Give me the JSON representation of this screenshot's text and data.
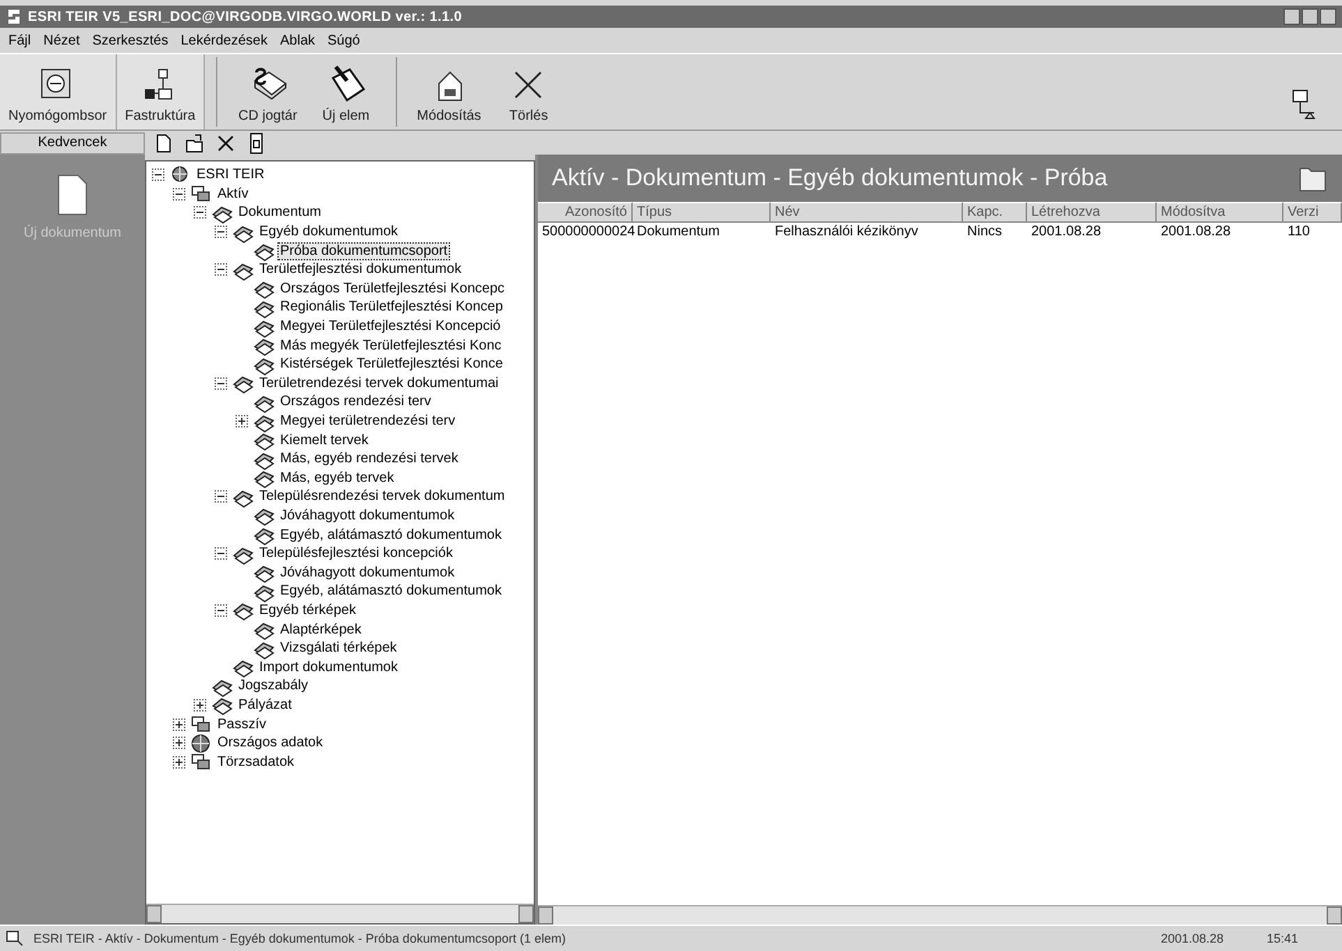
{
  "window": {
    "title": "ESRI TEIR V5_ESRI_DOC@VIRGODB.VIRGO.WORLD  ver.: 1.1.0"
  },
  "menu": [
    "Fájl",
    "Nézet",
    "Szerkesztés",
    "Lekérdezések",
    "Ablak",
    "Súgó"
  ],
  "toolbar": [
    {
      "kind": "keypad",
      "label": "Nyomógombsor"
    },
    {
      "kind": "tree",
      "label": "Fastruktúra"
    },
    {
      "kind": "book",
      "label": "CD jogtár"
    },
    {
      "kind": "pen",
      "label": "Új elem"
    },
    {
      "kind": "edit",
      "label": "Módosítás"
    },
    {
      "kind": "delete",
      "label": "Törlés"
    }
  ],
  "favorites": {
    "title": "Kedvencek",
    "items": [
      {
        "label": "Új dokumentum"
      }
    ]
  },
  "tree": {
    "items": [
      {
        "label": "ESRI TEIR",
        "kind": "root",
        "expanded": true,
        "selected": false,
        "children": [
          {
            "label": "Aktív",
            "kind": "group",
            "expanded": true,
            "selected": false,
            "children": [
              {
                "label": "Dokumentum",
                "kind": "folder",
                "expanded": true,
                "selected": false,
                "children": [
                  {
                    "label": "Egyéb dokumentumok",
                    "kind": "folder",
                    "expanded": true,
                    "selected": false,
                    "children": [
                      {
                        "label": "Próba dokumentumcsoport",
                        "kind": "folder",
                        "selected": true
                      }
                    ]
                  },
                  {
                    "label": "Területfejlesztési dokumentumok",
                    "kind": "folder",
                    "expanded": true,
                    "selected": false,
                    "children": [
                      {
                        "label": "Országos Területfejlesztési Koncepc",
                        "kind": "folder",
                        "selected": false
                      },
                      {
                        "label": "Regionális Területfejlesztési Koncep",
                        "kind": "folder",
                        "selected": false
                      },
                      {
                        "label": "Megyei Területfejlesztési Koncepció",
                        "kind": "folder",
                        "selected": false
                      },
                      {
                        "label": "Más megyék Területfejlesztési Konc",
                        "kind": "folder",
                        "selected": false
                      },
                      {
                        "label": "Kistérségek Területfejlesztési Konce",
                        "kind": "folder",
                        "selected": false
                      }
                    ]
                  },
                  {
                    "label": "Területrendezési tervek dokumentumai",
                    "kind": "folder",
                    "expanded": true,
                    "selected": false,
                    "children": [
                      {
                        "label": "Országos rendezési terv",
                        "kind": "folder",
                        "selected": false
                      },
                      {
                        "label": "Megyei területrendezési terv",
                        "kind": "folder",
                        "expanded": false,
                        "selected": false
                      },
                      {
                        "label": "Kiemelt tervek",
                        "kind": "folder",
                        "selected": false
                      },
                      {
                        "label": "Más, egyéb rendezési tervek",
                        "kind": "folder",
                        "selected": false
                      },
                      {
                        "label": "Más, egyéb tervek",
                        "kind": "folder",
                        "selected": false
                      }
                    ]
                  },
                  {
                    "label": "Településrendezési tervek dokumentum",
                    "kind": "folder",
                    "expanded": true,
                    "selected": false,
                    "children": [
                      {
                        "label": "Jóváhagyott dokumentumok",
                        "kind": "folder",
                        "selected": false
                      },
                      {
                        "label": "Egyéb, alátámasztó dokumentumok",
                        "kind": "folder",
                        "selected": false
                      }
                    ]
                  },
                  {
                    "label": "Településfejlesztési koncepciók",
                    "kind": "folder",
                    "expanded": true,
                    "selected": false,
                    "children": [
                      {
                        "label": "Jóváhagyott dokumentumok",
                        "kind": "folder",
                        "selected": false
                      },
                      {
                        "label": "Egyéb, alátámasztó dokumentumok",
                        "kind": "folder",
                        "selected": false
                      }
                    ]
                  },
                  {
                    "label": "Egyéb térképek",
                    "kind": "folder",
                    "expanded": true,
                    "selected": false,
                    "children": [
                      {
                        "label": "Alaptérképek",
                        "kind": "folder",
                        "selected": false
                      },
                      {
                        "label": "Vizsgálati térképek",
                        "kind": "folder",
                        "selected": false
                      }
                    ]
                  },
                  {
                    "label": "Import dokumentumok",
                    "kind": "folder",
                    "selected": false
                  }
                ]
              },
              {
                "label": "Jogszabály",
                "kind": "folder",
                "selected": false
              },
              {
                "label": "Pályázat",
                "kind": "folder",
                "expanded": false,
                "selected": false
              }
            ]
          },
          {
            "label": "Passzív",
            "kind": "group",
            "expanded": false,
            "selected": false
          },
          {
            "label": "Országos adatok",
            "kind": "globe",
            "expanded": false,
            "selected": false
          },
          {
            "label": "Törzsadatok",
            "kind": "group",
            "expanded": false,
            "selected": false
          }
        ]
      }
    ]
  },
  "content": {
    "title": "Aktív - Dokumentum - Egyéb dokumentumok - Próba",
    "columns": [
      "Azonosító",
      "Típus",
      "Név",
      "Kapc.",
      "Létrehozva",
      "Módosítva",
      "Verzi"
    ],
    "rows": [
      [
        "500000000024",
        "Dokumentum",
        "Felhasználói kézikönyv",
        "Nincs",
        "2001.08.28",
        "2001.08.28",
        "110"
      ]
    ]
  },
  "status_bar": {
    "path": "ESRI TEIR - Aktív - Dokumentum - Egyéb dokumentumok - Próba dokumentumcsoport (1 elem)",
    "date": "2001.08.28",
    "time": "15:41"
  }
}
